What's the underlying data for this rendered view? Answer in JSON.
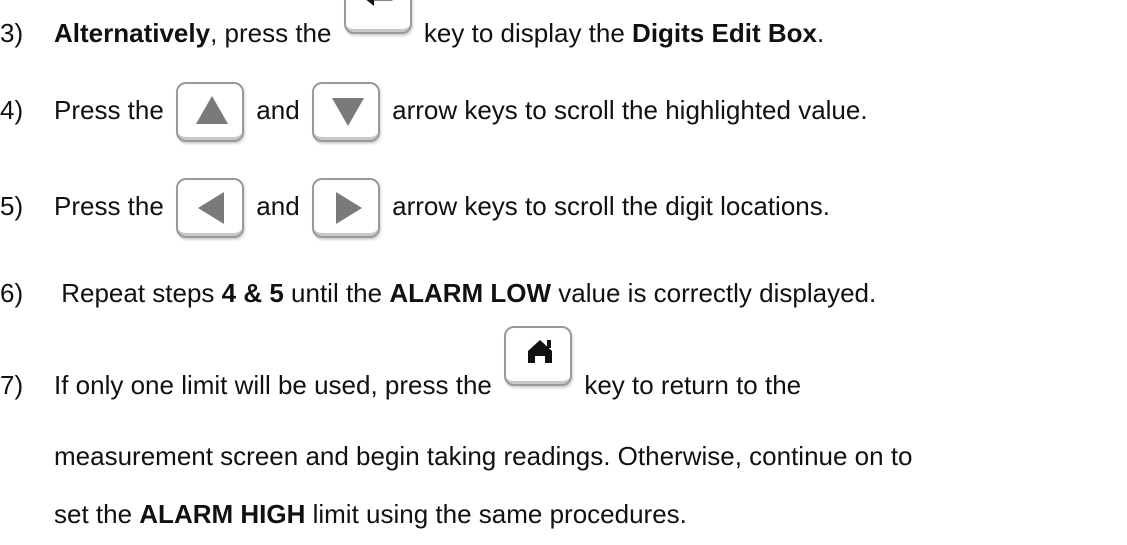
{
  "steps": [
    {
      "number": "3)",
      "lead": "Alternatively",
      "t1": ", press the ",
      "t2": " key to display the ",
      "b2": "Digits Edit Box",
      "t3": "."
    },
    {
      "number": "4)",
      "t1": "Press the ",
      "t2": " and ",
      "t3": " arrow keys to scroll the highlighted value."
    },
    {
      "number": "5)",
      "t1": "Press the ",
      "t2": " and ",
      "t3": " arrow keys to scroll the digit locations."
    },
    {
      "number": "6)",
      "t1": " Repeat steps ",
      "b1": "4 & 5",
      "t2": " until the ",
      "b2": "ALARM LOW",
      "t3": " value is correctly displayed."
    },
    {
      "number": "7)",
      "t1": "If only one limit will be used, press the ",
      "t2": " key to return to the",
      "line2": "measurement screen and begin taking readings.  Otherwise, continue on to",
      "line3a": "set the ",
      "line3b": "ALARM HIGH",
      "line3c": " limit using the same procedures."
    }
  ],
  "icons": {
    "enter": "enter-key-icon",
    "up": "up-arrow-key-icon",
    "down": "down-arrow-key-icon",
    "left": "left-arrow-key-icon",
    "right": "right-arrow-key-icon",
    "home": "home-key-icon"
  },
  "colors": {
    "text": "#111111",
    "key_border": "#9a9a9a",
    "key_glyph": "#7a7a7a",
    "home_glyph": "#111111"
  }
}
